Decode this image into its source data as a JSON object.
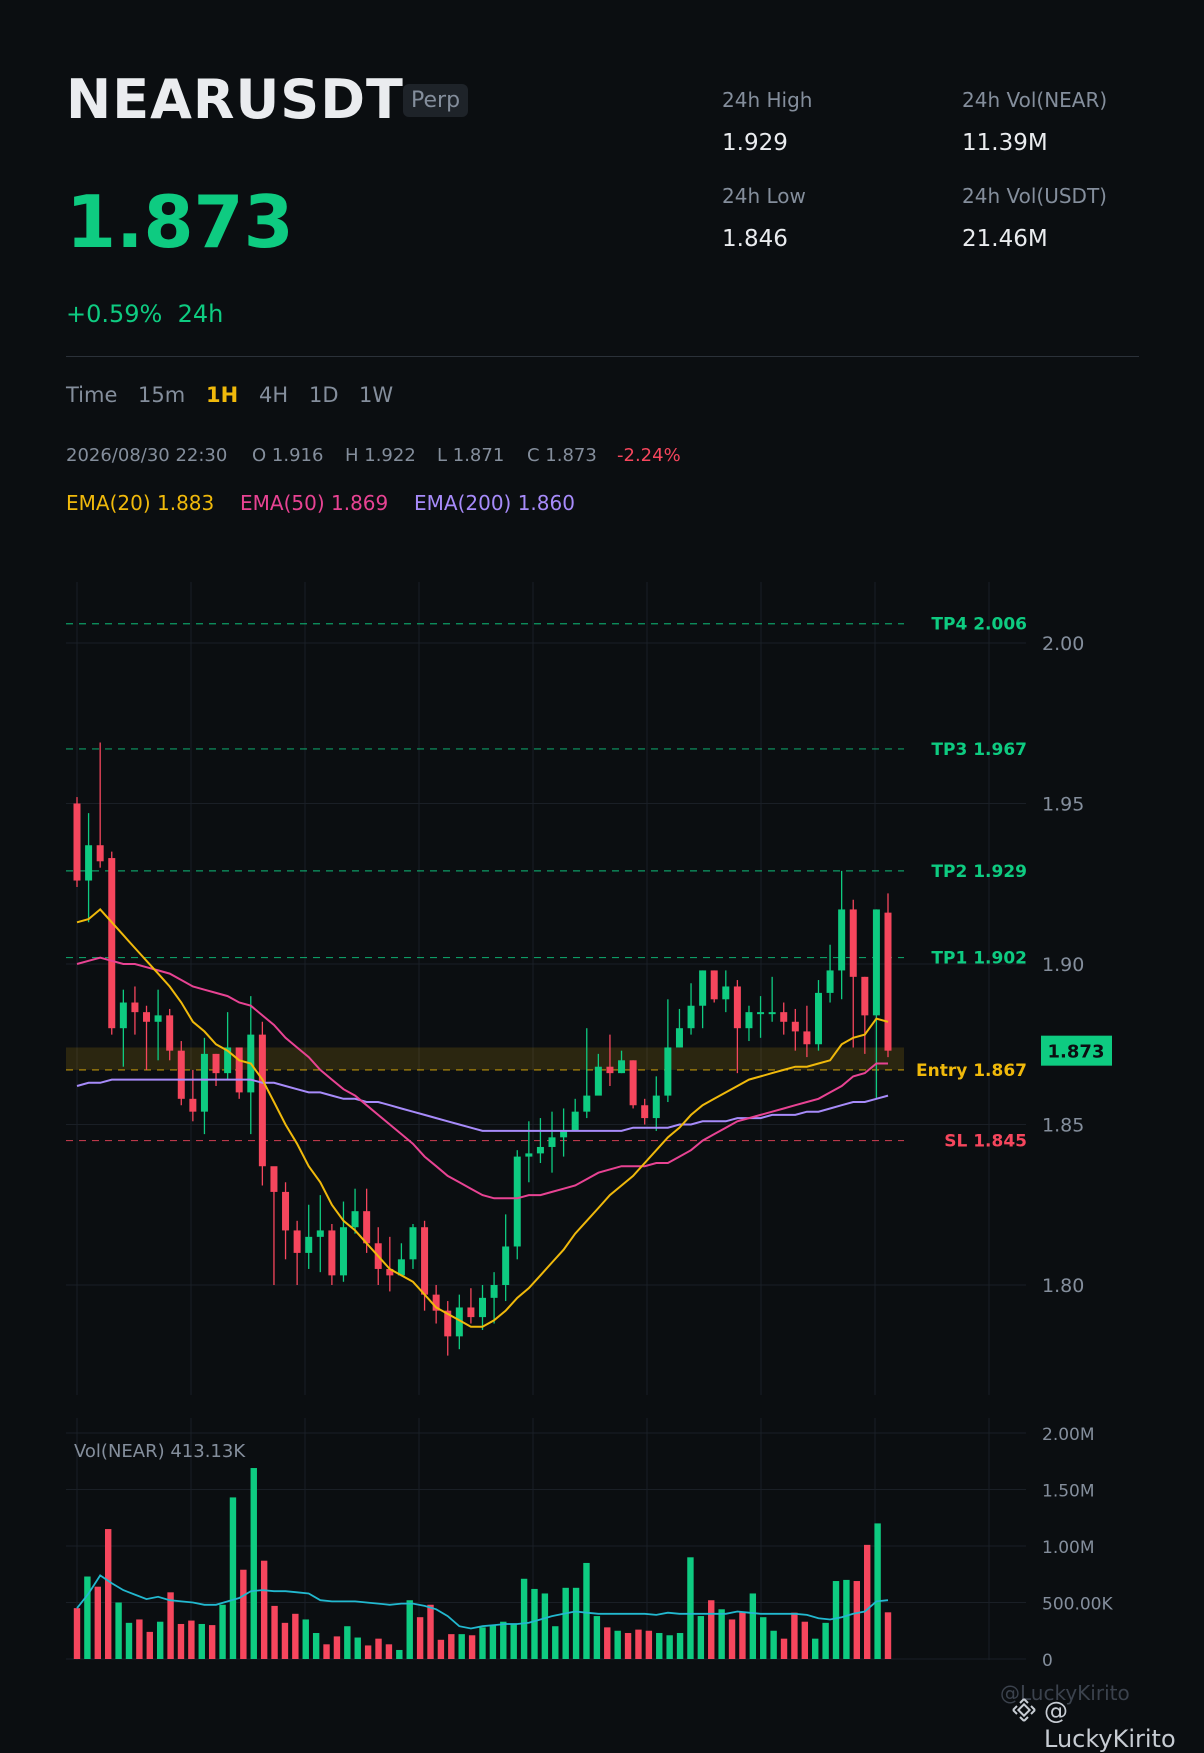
{
  "header": {
    "symbol": "NEARUSDT",
    "badge": "Perp",
    "last_price": "1.873",
    "change_pct": "+0.59%",
    "change_period": "24h",
    "stats": [
      {
        "label": "24h High",
        "value": "1.929"
      },
      {
        "label": "24h Vol(NEAR)",
        "value": "11.39M"
      },
      {
        "label": "24h Low",
        "value": "1.846"
      },
      {
        "label": "24h Vol(USDT)",
        "value": "21.46M"
      }
    ]
  },
  "timeframes": [
    "Time",
    "15m",
    "1H",
    "4H",
    "1D",
    "1W"
  ],
  "active_timeframe": "1H",
  "ohlc_bar": {
    "datetime": "2026/08/30 22:30",
    "open": "O 1.916",
    "high": "H 1.922",
    "low": "L 1.871",
    "close": "C 1.873",
    "change": "-2.24%"
  },
  "ema_legend": [
    {
      "label": "EMA(20) 1.883",
      "color": "#f0b90b"
    },
    {
      "label": "EMA(50) 1.869",
      "color": "#e84393"
    },
    {
      "label": "EMA(200) 1.860",
      "color": "#a78bfa"
    }
  ],
  "colors": {
    "up": "#0ecb81",
    "down": "#f6465d",
    "background": "#0b0e11",
    "grid": "#1a1f26",
    "entry": "#f0b90b",
    "ema20": "#f0b90b",
    "ema50": "#e84393",
    "ema200": "#a78bfa",
    "vol_ma": "#22b8cf"
  },
  "chart_data": [
    {
      "type": "candlestick",
      "y_ticks": [
        "2.00",
        "1.95",
        "1.90",
        "1.85",
        "1.80"
      ],
      "ylim": [
        1.775,
        2.015
      ],
      "last_price_label": "1.873",
      "levels": [
        {
          "name": "TP4",
          "label": "TP4 2.006",
          "value": 2.006,
          "color": "#0ecb81"
        },
        {
          "name": "TP3",
          "label": "TP3 1.967",
          "value": 1.967,
          "color": "#0ecb81"
        },
        {
          "name": "TP2",
          "label": "TP2 1.929",
          "value": 1.929,
          "color": "#0ecb81"
        },
        {
          "name": "TP1",
          "label": "TP1 1.902",
          "value": 1.902,
          "color": "#0ecb81"
        },
        {
          "name": "Entry",
          "label": "Entry 1.867",
          "value": 1.867,
          "color": "#f0b90b"
        },
        {
          "name": "SL",
          "label": "SL 1.845",
          "value": 1.845,
          "color": "#f6465d"
        }
      ],
      "entry_zone": [
        1.867,
        1.874
      ],
      "candles": [
        [
          1.95,
          1.926,
          1.952,
          1.924
        ],
        [
          1.926,
          1.937,
          1.947,
          1.913
        ],
        [
          1.937,
          1.932,
          1.969,
          1.93
        ],
        [
          1.933,
          1.88,
          1.935,
          1.878
        ],
        [
          1.88,
          1.888,
          1.892,
          1.868
        ],
        [
          1.888,
          1.885,
          1.893,
          1.878
        ],
        [
          1.885,
          1.882,
          1.887,
          1.867
        ],
        [
          1.882,
          1.884,
          1.892,
          1.87
        ],
        [
          1.884,
          1.873,
          1.886,
          1.87
        ],
        [
          1.873,
          1.858,
          1.876,
          1.856
        ],
        [
          1.858,
          1.854,
          1.867,
          1.851
        ],
        [
          1.854,
          1.872,
          1.877,
          1.847
        ],
        [
          1.872,
          1.866,
          1.872,
          1.862
        ],
        [
          1.866,
          1.874,
          1.885,
          1.864
        ],
        [
          1.874,
          1.86,
          1.868,
          1.858
        ],
        [
          1.86,
          1.878,
          1.89,
          1.847
        ],
        [
          1.878,
          1.837,
          1.882,
          1.831
        ],
        [
          1.837,
          1.829,
          1.833,
          1.8
        ],
        [
          1.829,
          1.817,
          1.832,
          1.808
        ],
        [
          1.817,
          1.81,
          1.82,
          1.8
        ],
        [
          1.81,
          1.815,
          1.825,
          1.805
        ],
        [
          1.815,
          1.817,
          1.828,
          1.804
        ],
        [
          1.817,
          1.803,
          1.819,
          1.8
        ],
        [
          1.803,
          1.818,
          1.826,
          1.801
        ],
        [
          1.818,
          1.823,
          1.83,
          1.816
        ],
        [
          1.823,
          1.813,
          1.83,
          1.81
        ],
        [
          1.813,
          1.805,
          1.818,
          1.8
        ],
        [
          1.805,
          1.803,
          1.815,
          1.798
        ],
        [
          1.803,
          1.808,
          1.813,
          1.805
        ],
        [
          1.808,
          1.818,
          1.819,
          1.805
        ],
        [
          1.818,
          1.797,
          1.82,
          1.792
        ],
        [
          1.797,
          1.792,
          1.8,
          1.788
        ],
        [
          1.792,
          1.784,
          1.795,
          1.778
        ],
        [
          1.784,
          1.793,
          1.797,
          1.78
        ],
        [
          1.793,
          1.79,
          1.799,
          1.788
        ],
        [
          1.79,
          1.796,
          1.8,
          1.786
        ],
        [
          1.796,
          1.8,
          1.804,
          1.788
        ],
        [
          1.8,
          1.812,
          1.822,
          1.795
        ],
        [
          1.812,
          1.84,
          1.842,
          1.808
        ],
        [
          1.84,
          1.841,
          1.851,
          1.832
        ],
        [
          1.841,
          1.843,
          1.852,
          1.838
        ],
        [
          1.843,
          1.846,
          1.854,
          1.835
        ],
        [
          1.846,
          1.848,
          1.855,
          1.84
        ],
        [
          1.848,
          1.854,
          1.858,
          1.848
        ],
        [
          1.854,
          1.859,
          1.88,
          1.852
        ],
        [
          1.859,
          1.868,
          1.872,
          1.86
        ],
        [
          1.868,
          1.866,
          1.878,
          1.862
        ],
        [
          1.866,
          1.87,
          1.873,
          1.866
        ],
        [
          1.87,
          1.856,
          1.87,
          1.855
        ],
        [
          1.856,
          1.852,
          1.858,
          1.85
        ],
        [
          1.852,
          1.859,
          1.865,
          1.848
        ],
        [
          1.859,
          1.874,
          1.889,
          1.857
        ],
        [
          1.874,
          1.88,
          1.886,
          1.874
        ],
        [
          1.88,
          1.887,
          1.894,
          1.878
        ],
        [
          1.887,
          1.898,
          1.898,
          1.88
        ],
        [
          1.898,
          1.889,
          1.898,
          1.888
        ],
        [
          1.889,
          1.893,
          1.898,
          1.885
        ],
        [
          1.893,
          1.88,
          1.895,
          1.866
        ],
        [
          1.88,
          1.885,
          1.887,
          1.876
        ],
        [
          1.885,
          1.885,
          1.89,
          1.877
        ],
        [
          1.885,
          1.885,
          1.896,
          1.882
        ],
        [
          1.885,
          1.882,
          1.888,
          1.878
        ],
        [
          1.882,
          1.879,
          1.886,
          1.873
        ],
        [
          1.879,
          1.875,
          1.887,
          1.871
        ],
        [
          1.875,
          1.891,
          1.895,
          1.873
        ],
        [
          1.891,
          1.898,
          1.906,
          1.888
        ],
        [
          1.898,
          1.917,
          1.929,
          1.889
        ],
        [
          1.917,
          1.896,
          1.92,
          1.874
        ],
        [
          1.896,
          1.884,
          1.896,
          1.872
        ],
        [
          1.884,
          1.917,
          1.917,
          1.858
        ],
        [
          1.916,
          1.873,
          1.922,
          1.871
        ]
      ],
      "ema20": [
        1.913,
        1.914,
        1.917,
        1.913,
        1.909,
        1.905,
        1.901,
        1.897,
        1.893,
        1.888,
        1.882,
        1.879,
        1.875,
        1.873,
        1.87,
        1.869,
        1.864,
        1.857,
        1.85,
        1.844,
        1.837,
        1.832,
        1.825,
        1.82,
        1.817,
        1.813,
        1.809,
        1.805,
        1.803,
        1.801,
        1.797,
        1.793,
        1.791,
        1.789,
        1.787,
        1.787,
        1.789,
        1.792,
        1.796,
        1.799,
        1.803,
        1.807,
        1.811,
        1.816,
        1.82,
        1.824,
        1.828,
        1.831,
        1.834,
        1.838,
        1.842,
        1.846,
        1.849,
        1.853,
        1.856,
        1.858,
        1.86,
        1.862,
        1.864,
        1.865,
        1.866,
        1.867,
        1.868,
        1.868,
        1.869,
        1.87,
        1.875,
        1.877,
        1.878,
        1.883,
        1.882
      ],
      "ema50": [
        1.9,
        1.901,
        1.902,
        1.901,
        1.9,
        1.9,
        1.899,
        1.898,
        1.897,
        1.895,
        1.893,
        1.892,
        1.891,
        1.89,
        1.888,
        1.887,
        1.884,
        1.881,
        1.877,
        1.874,
        1.871,
        1.867,
        1.864,
        1.861,
        1.859,
        1.856,
        1.853,
        1.85,
        1.847,
        1.844,
        1.84,
        1.837,
        1.834,
        1.832,
        1.83,
        1.828,
        1.827,
        1.827,
        1.827,
        1.828,
        1.828,
        1.829,
        1.83,
        1.831,
        1.833,
        1.835,
        1.836,
        1.837,
        1.837,
        1.837,
        1.838,
        1.838,
        1.84,
        1.842,
        1.845,
        1.847,
        1.849,
        1.851,
        1.852,
        1.853,
        1.854,
        1.855,
        1.856,
        1.857,
        1.858,
        1.86,
        1.862,
        1.865,
        1.866,
        1.869,
        1.869
      ],
      "ema200": [
        1.862,
        1.863,
        1.863,
        1.864,
        1.864,
        1.864,
        1.864,
        1.864,
        1.864,
        1.864,
        1.864,
        1.864,
        1.864,
        1.864,
        1.864,
        1.864,
        1.863,
        1.863,
        1.862,
        1.861,
        1.86,
        1.86,
        1.859,
        1.858,
        1.858,
        1.857,
        1.857,
        1.856,
        1.855,
        1.854,
        1.853,
        1.852,
        1.851,
        1.85,
        1.849,
        1.848,
        1.848,
        1.848,
        1.848,
        1.848,
        1.848,
        1.848,
        1.848,
        1.848,
        1.848,
        1.848,
        1.848,
        1.848,
        1.849,
        1.849,
        1.849,
        1.849,
        1.85,
        1.85,
        1.851,
        1.851,
        1.851,
        1.852,
        1.852,
        1.852,
        1.853,
        1.853,
        1.853,
        1.854,
        1.854,
        1.855,
        1.856,
        1.857,
        1.857,
        1.858,
        1.859
      ]
    },
    {
      "type": "bar",
      "title": "Vol(NEAR) 413.13K",
      "y_ticks": [
        "2.00M",
        "1.50M",
        "1.00M",
        "500.00K",
        "0"
      ],
      "ylim": [
        0,
        2000000
      ],
      "volume": [
        450000,
        730000,
        640000,
        1150000,
        500000,
        320000,
        350000,
        240000,
        330000,
        590000,
        310000,
        340000,
        310000,
        300000,
        480000,
        1430000,
        790000,
        1690000,
        870000,
        470000,
        320000,
        400000,
        350000,
        230000,
        130000,
        200000,
        290000,
        190000,
        120000,
        180000,
        130000,
        80000,
        520000,
        370000,
        480000,
        170000,
        220000,
        220000,
        210000,
        280000,
        300000,
        330000,
        310000,
        710000,
        620000,
        580000,
        290000,
        630000,
        630000,
        850000,
        380000,
        280000,
        250000,
        230000,
        260000,
        250000,
        230000,
        210000,
        230000,
        900000,
        380000,
        520000,
        440000,
        350000,
        420000,
        580000,
        370000,
        250000,
        180000,
        410000,
        330000,
        180000,
        320000,
        690000,
        700000,
        690000,
        1010000,
        1200000,
        413130
      ],
      "volume_ma": [
        450000,
        580000,
        740000,
        670000,
        610000,
        570000,
        530000,
        550000,
        520000,
        510000,
        500000,
        480000,
        480000,
        510000,
        540000,
        600000,
        610000,
        600000,
        600000,
        590000,
        580000,
        520000,
        510000,
        510000,
        510000,
        500000,
        490000,
        480000,
        490000,
        490000,
        470000,
        440000,
        380000,
        290000,
        270000,
        290000,
        300000,
        310000,
        310000,
        320000,
        350000,
        380000,
        400000,
        420000,
        410000,
        400000,
        400000,
        400000,
        400000,
        400000,
        390000,
        410000,
        400000,
        400000,
        400000,
        400000,
        400000,
        420000,
        410000,
        400000,
        400000,
        400000,
        400000,
        390000,
        360000,
        350000,
        370000,
        400000,
        420000,
        510000,
        520000
      ]
    }
  ],
  "watermark": {
    "handle_faint": "@LuckyKirito",
    "handle": "@ LuckyKirito",
    "icon": "binance-logo-icon"
  }
}
